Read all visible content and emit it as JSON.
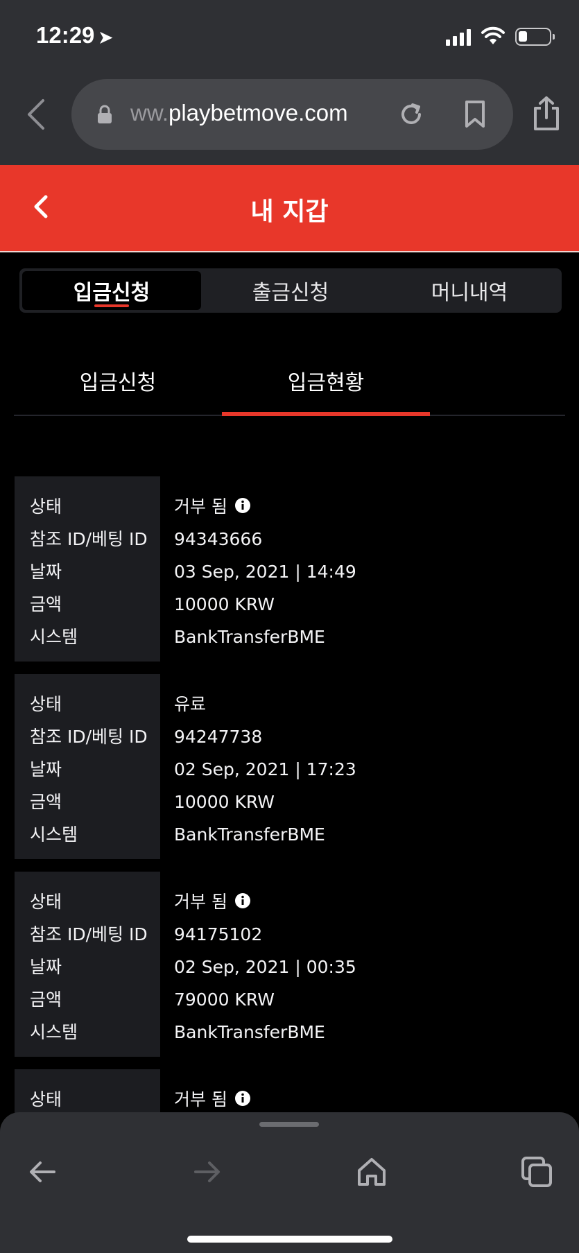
{
  "status_bar": {
    "time": "12:29"
  },
  "browser": {
    "url_prefix": "ww.",
    "url_domain": "playbetmove.com"
  },
  "header": {
    "title": "내 지갑"
  },
  "top_tabs": [
    {
      "label": "입금신청",
      "active": true
    },
    {
      "label": "출금신청",
      "active": false
    },
    {
      "label": "머니내역",
      "active": false
    }
  ],
  "sub_tabs": [
    {
      "label": "입금신청",
      "active": false
    },
    {
      "label": "입금현황",
      "active": true
    }
  ],
  "labels": {
    "status": "상태",
    "ref_id": "참조 ID/베팅 ID",
    "date": "날짜",
    "amount": "금액",
    "system": "시스템"
  },
  "records": [
    {
      "status": "거부 됨",
      "ref_id": "94343666",
      "date": "03 Sep, 2021 | 14:49",
      "amount": "10000 KRW",
      "system": "BankTransferBME"
    },
    {
      "status": "유료",
      "ref_id": "94247738",
      "date": "02 Sep, 2021 | 17:23",
      "amount": "10000 KRW",
      "system": "BankTransferBME"
    },
    {
      "status": "거부 됨",
      "ref_id": "94175102",
      "date": "02 Sep, 2021 | 00:35",
      "amount": "79000 KRW",
      "system": "BankTransferBME"
    },
    {
      "status": "거부 됨"
    }
  ],
  "colors": {
    "accent": "#e8372a",
    "chrome": "#2f3034",
    "panel": "#1c1d21"
  },
  "icons": [
    "location-arrow-icon",
    "signal-icon",
    "wifi-icon",
    "battery-icon",
    "back-chevron-icon",
    "lock-icon",
    "reload-icon",
    "bookmark-icon",
    "share-icon",
    "info-icon",
    "back-arrow-icon",
    "forward-arrow-icon",
    "home-icon",
    "tabs-icon"
  ]
}
